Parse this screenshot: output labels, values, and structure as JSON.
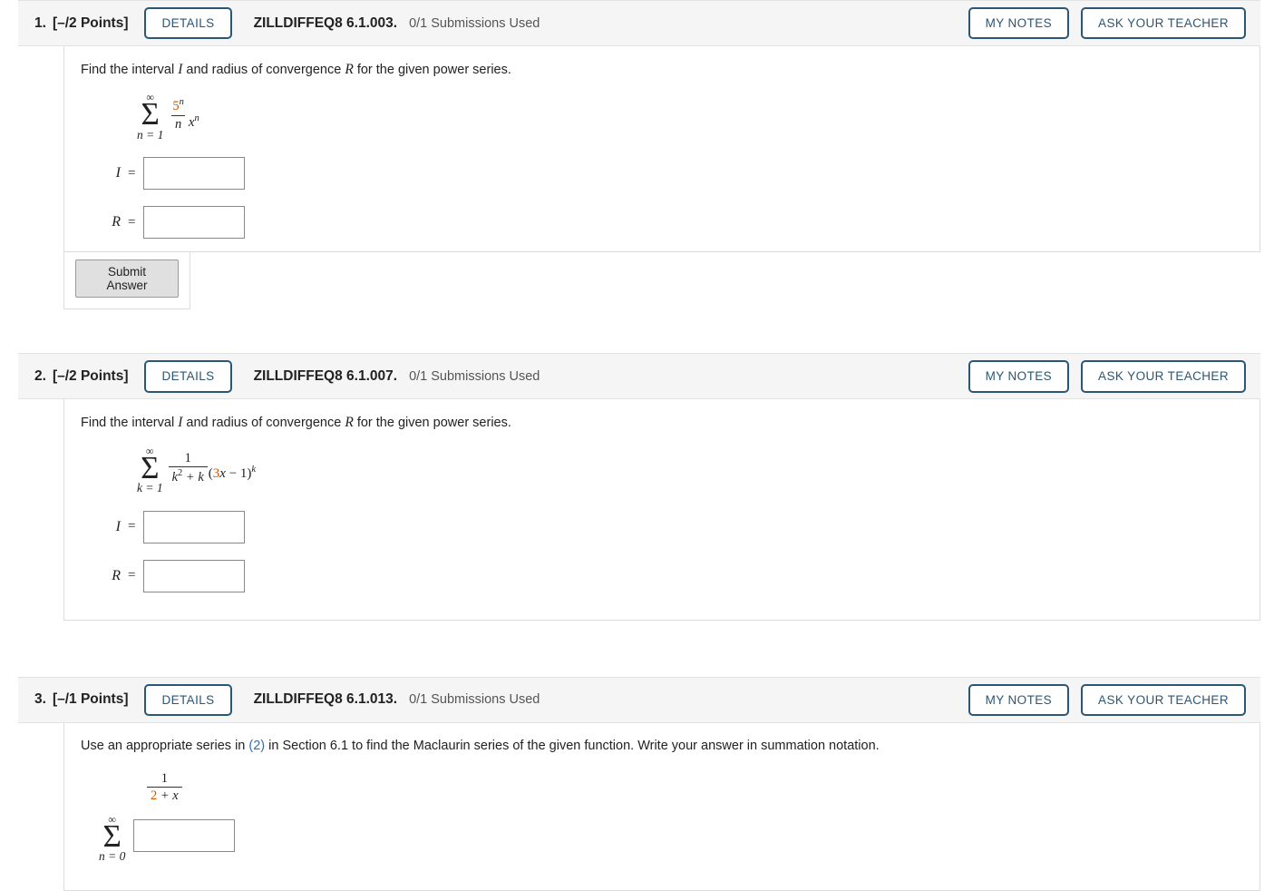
{
  "colors": {
    "accent_blue": "#2b5674",
    "link_blue": "#3a6ea5",
    "math_orange": "#cc5500",
    "header_bg": "#f5f5f5",
    "panel_border": "#dcdcdc"
  },
  "buttons": {
    "details": "DETAILS",
    "my_notes": "MY NOTES",
    "ask_your_teacher": "ASK YOUR TEACHER",
    "submit_answer": "Submit Answer"
  },
  "problems": [
    {
      "number": "1.",
      "points": "[–/2 Points]",
      "code": "ZILLDIFFEQ8 6.1.003.",
      "submissions": "0/1 Submissions Used",
      "question_prefix": "Find the interval ",
      "question_var1": "I",
      "question_mid": " and radius of convergence ",
      "question_var2": "R",
      "question_suffix": " for the given power series.",
      "math": {
        "sigma_top": "∞",
        "sigma_bottom": "n = 1",
        "numerator_base": "5",
        "numerator_exp": "n",
        "denominator": "n",
        "tail_base": "x",
        "tail_exp": "n"
      },
      "answers": [
        {
          "label": "I",
          "eq": "=",
          "value": "",
          "placeholder": ""
        },
        {
          "label": "R",
          "eq": "=",
          "value": "",
          "placeholder": ""
        }
      ],
      "has_submit": true
    },
    {
      "number": "2.",
      "points": "[–/2 Points]",
      "code": "ZILLDIFFEQ8 6.1.007.",
      "submissions": "0/1 Submissions Used",
      "question_prefix": "Find the interval ",
      "question_var1": "I",
      "question_mid": " and radius of convergence ",
      "question_var2": "R",
      "question_suffix": " for the given power series.",
      "math": {
        "sigma_top": "∞",
        "sigma_bottom": "k = 1",
        "numerator": "1",
        "denominator_k": "k",
        "denominator_exp": "2",
        "denominator_tail": " + k",
        "paren_open": "(",
        "paren_coeff": "3",
        "paren_var": "x",
        "paren_minus": " − 1",
        "paren_close": ")",
        "paren_exp": "k"
      },
      "answers": [
        {
          "label": "I",
          "eq": "=",
          "value": "",
          "placeholder": ""
        },
        {
          "label": "R",
          "eq": "=",
          "value": "",
          "placeholder": ""
        }
      ],
      "has_submit": false
    },
    {
      "number": "3.",
      "points": "[–/1 Points]",
      "code": "ZILLDIFFEQ8 6.1.013.",
      "submissions": "0/1 Submissions Used",
      "question_p1": "Use an appropriate series in ",
      "question_link": "(2)",
      "question_p2": " in Section 6.1 to find the Maclaurin series of the given function. Write your answer in summation notation.",
      "math": {
        "numerator": "1",
        "denominator_num": "2",
        "denominator_tail": " + x",
        "sigma_top": "∞",
        "sigma_bottom": "n = 0"
      },
      "answers": [
        {
          "label": "",
          "eq": "",
          "value": "",
          "placeholder": ""
        }
      ],
      "has_submit": false
    }
  ]
}
